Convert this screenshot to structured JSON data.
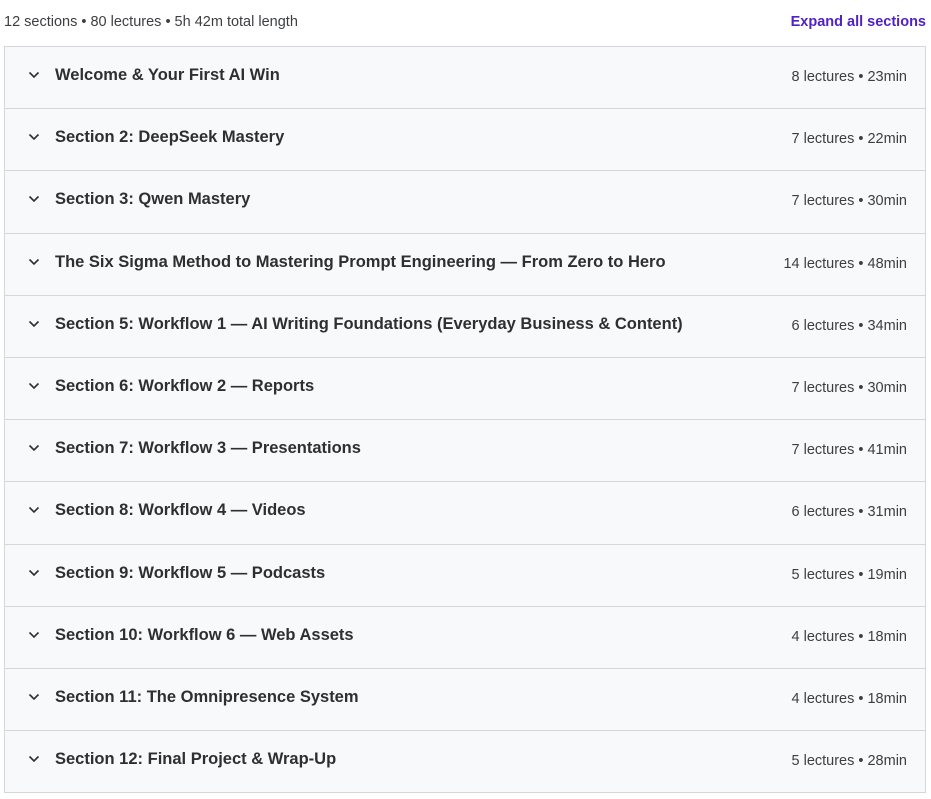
{
  "summary": "12 sections • 80 lectures • 5h 42m total length",
  "expand_label": "Expand all sections",
  "accent_color": "#5022c3",
  "sections": [
    {
      "title": "Welcome & Your First AI Win",
      "meta": "8 lectures • 23min"
    },
    {
      "title": "Section 2: DeepSeek Mastery",
      "meta": "7 lectures • 22min"
    },
    {
      "title": "Section 3: Qwen Mastery",
      "meta": "7 lectures • 30min"
    },
    {
      "title": "The Six Sigma Method to Mastering Prompt Engineering — From Zero to Hero",
      "meta": "14 lectures • 48min"
    },
    {
      "title": "Section 5: Workflow 1 — AI Writing Foundations (Everyday Business & Content)",
      "meta": "6 lectures • 34min"
    },
    {
      "title": "Section 6: Workflow 2 — Reports",
      "meta": "7 lectures • 30min"
    },
    {
      "title": "Section 7: Workflow 3 — Presentations",
      "meta": "7 lectures • 41min"
    },
    {
      "title": "Section 8: Workflow 4 — Videos",
      "meta": "6 lectures • 31min"
    },
    {
      "title": "Section 9: Workflow 5 — Podcasts",
      "meta": "5 lectures • 19min"
    },
    {
      "title": "Section 10: Workflow 6 — Web Assets",
      "meta": "4 lectures • 18min"
    },
    {
      "title": "Section 11: The Omnipresence System",
      "meta": "4 lectures • 18min"
    },
    {
      "title": "Section 12: Final Project & Wrap-Up",
      "meta": "5 lectures • 28min"
    }
  ]
}
